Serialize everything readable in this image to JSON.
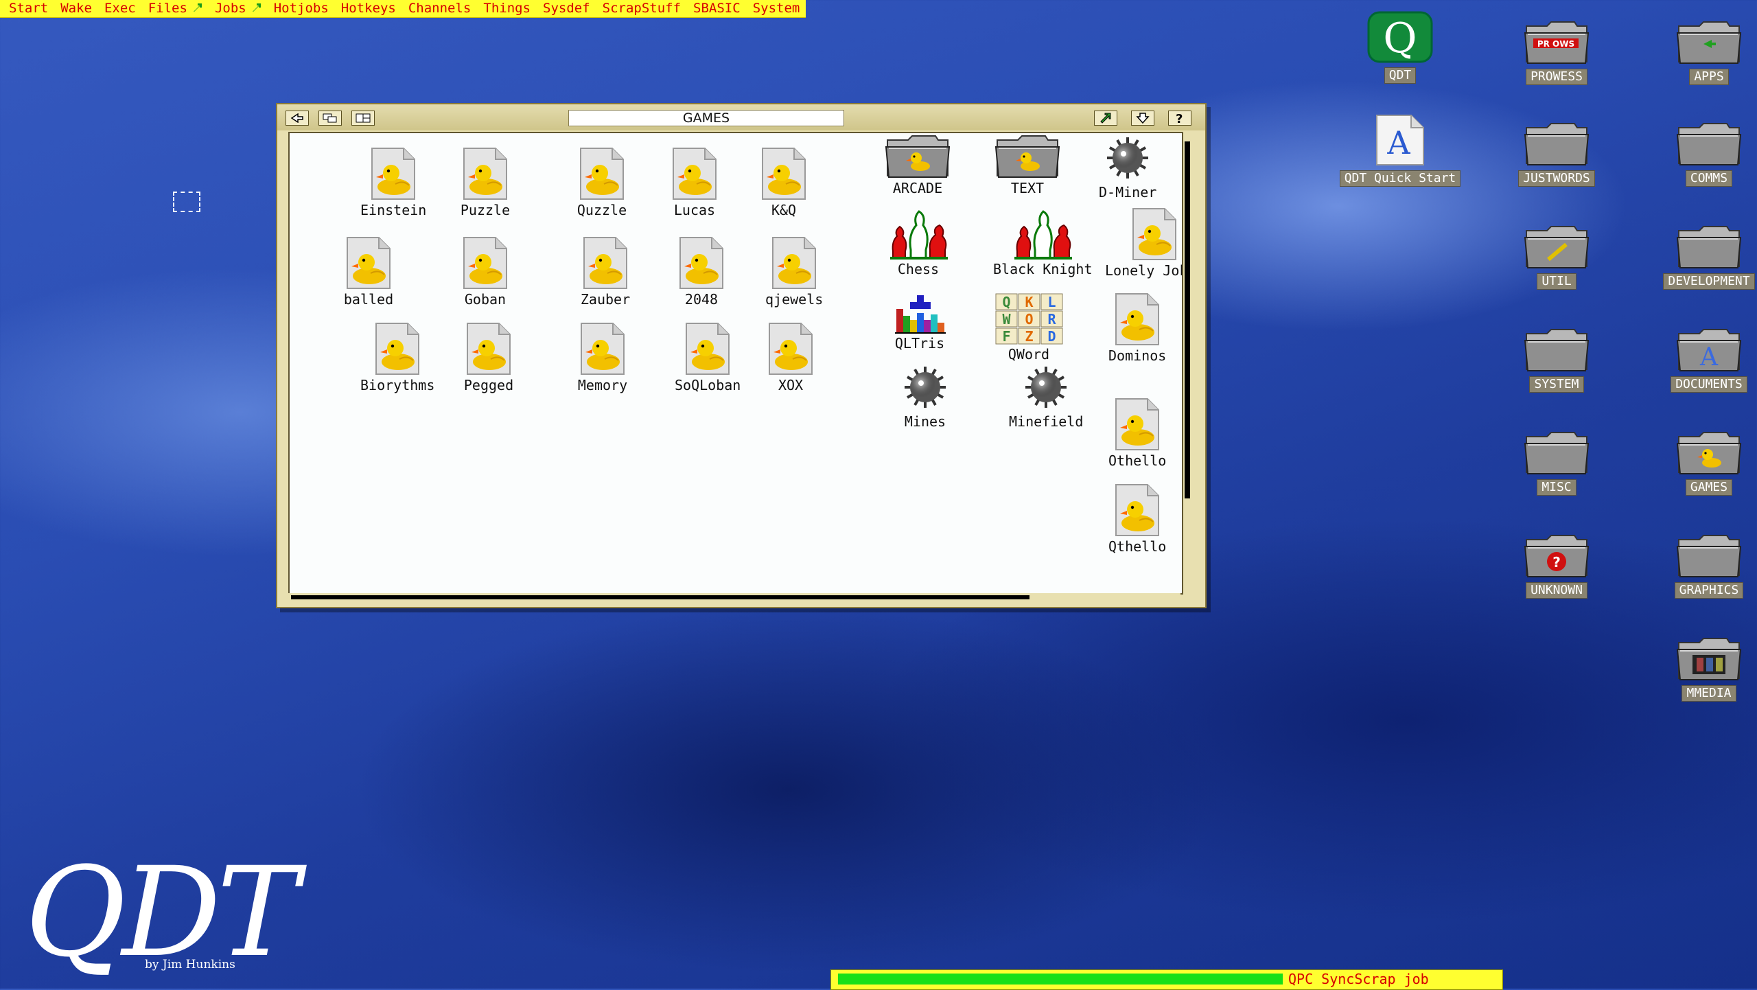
{
  "menubar": {
    "items": [
      {
        "label": "Start",
        "arrow": false
      },
      {
        "label": "Wake",
        "arrow": false
      },
      {
        "label": "Exec",
        "arrow": false
      },
      {
        "label": "Files",
        "arrow": true
      },
      {
        "label": "Jobs",
        "arrow": true
      },
      {
        "label": "Hotjobs",
        "arrow": false
      },
      {
        "label": "Hotkeys",
        "arrow": false
      },
      {
        "label": "Channels",
        "arrow": false
      },
      {
        "label": "Things",
        "arrow": false
      },
      {
        "label": "Sysdef",
        "arrow": false
      },
      {
        "label": "ScrapStuff",
        "arrow": false
      },
      {
        "label": "SBASIC",
        "arrow": false
      },
      {
        "label": "System",
        "arrow": false
      }
    ]
  },
  "window": {
    "title": "GAMES",
    "icons": [
      {
        "label": "Einstein",
        "kind": "duck"
      },
      {
        "label": "Puzzle",
        "kind": "duck"
      },
      {
        "label": "Quzzle",
        "kind": "duck"
      },
      {
        "label": "Lucas",
        "kind": "duck"
      },
      {
        "label": "K&Q",
        "kind": "duck"
      },
      {
        "label": "ARCADE",
        "kind": "folder-duck"
      },
      {
        "label": "TEXT",
        "kind": "folder-duck"
      },
      {
        "label": "D-Miner",
        "kind": "mine"
      },
      {
        "label": "balled",
        "kind": "duck"
      },
      {
        "label": "Goban",
        "kind": "duck"
      },
      {
        "label": "Zauber",
        "kind": "duck"
      },
      {
        "label": "2048",
        "kind": "duck"
      },
      {
        "label": "qjewels",
        "kind": "duck"
      },
      {
        "label": "Chess",
        "kind": "chess"
      },
      {
        "label": "Black Knight",
        "kind": "chess"
      },
      {
        "label": "Lonely Joker",
        "kind": "duck"
      },
      {
        "label": "QLTris",
        "kind": "tetris"
      },
      {
        "label": "QWord",
        "kind": "qword"
      },
      {
        "label": "Dominos",
        "kind": "duck"
      },
      {
        "label": "Biorythms",
        "kind": "duck"
      },
      {
        "label": "Pegged",
        "kind": "duck"
      },
      {
        "label": "Memory",
        "kind": "duck"
      },
      {
        "label": "SoQLoban",
        "kind": "duck"
      },
      {
        "label": "XOX",
        "kind": "duck"
      },
      {
        "label": "Mines",
        "kind": "mine"
      },
      {
        "label": "Minefield",
        "kind": "mine"
      },
      {
        "label": "Othello",
        "kind": "duck"
      },
      {
        "label": "Qthello",
        "kind": "duck"
      }
    ],
    "qword_letters": [
      "Q",
      "K",
      "L",
      "W",
      "O",
      "R",
      "F",
      "Z",
      "D"
    ]
  },
  "desktop": {
    "icons": [
      {
        "label": "QDT",
        "kind": "qdt"
      },
      {
        "label": "PROWESS",
        "kind": "folder-red"
      },
      {
        "label": "APPS",
        "kind": "folder-arrow"
      },
      {
        "label": "QDT Quick Start",
        "kind": "doc-a"
      },
      {
        "label": "JUSTWORDS",
        "kind": "folder-plain"
      },
      {
        "label": "COMMS",
        "kind": "folder-plain"
      },
      {
        "label": "UTIL",
        "kind": "folder-pen"
      },
      {
        "label": "DEVELOPMENT",
        "kind": "folder-plain"
      },
      {
        "label": "SYSTEM",
        "kind": "folder-plain"
      },
      {
        "label": "DOCUMENTS",
        "kind": "folder-a"
      },
      {
        "label": "MISC",
        "kind": "folder-plain"
      },
      {
        "label": "GAMES",
        "kind": "folder-duck"
      },
      {
        "label": "UNKNOWN",
        "kind": "folder-q"
      },
      {
        "label": "GRAPHICS",
        "kind": "folder-plain"
      },
      {
        "label": "MMEDIA",
        "kind": "folder-film"
      }
    ],
    "prowess_badge": "PR OWS",
    "doc_letter": "A"
  },
  "logo": {
    "text": "QDT",
    "sub": "by Jim Hunkins"
  },
  "status": {
    "text": "QPC SyncScrap job",
    "progress": 1.0
  },
  "colors": {
    "menu_bg": "#ffff30",
    "menu_text": "#d60000",
    "window_frame": "#e8e0b0",
    "progress": "#18e018"
  }
}
